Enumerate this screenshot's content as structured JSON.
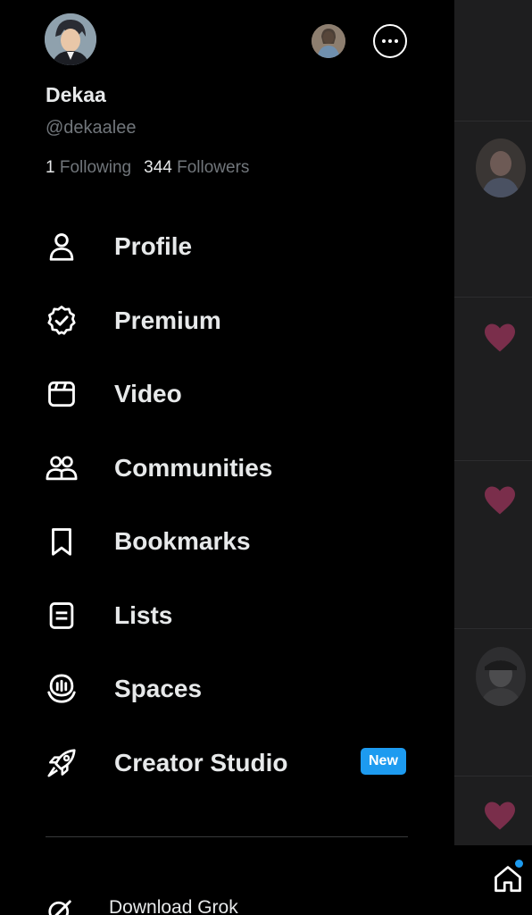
{
  "profile": {
    "display_name": "Dekaa",
    "handle": "@dekaalee",
    "following_count": "1",
    "following_label": "Following",
    "followers_count": "344",
    "followers_label": "Followers"
  },
  "menu": [
    {
      "label": "Profile",
      "icon": "person-icon"
    },
    {
      "label": "Premium",
      "icon": "verified-badge-icon"
    },
    {
      "label": "Video",
      "icon": "video-clapper-icon"
    },
    {
      "label": "Communities",
      "icon": "communities-icon"
    },
    {
      "label": "Bookmarks",
      "icon": "bookmark-icon"
    },
    {
      "label": "Lists",
      "icon": "list-icon"
    },
    {
      "label": "Spaces",
      "icon": "spaces-mic-icon"
    },
    {
      "label": "Creator Studio",
      "icon": "rocket-icon",
      "badge": "New"
    }
  ],
  "footer": {
    "grok_label": "Download Grok",
    "grok_icon": "grok-icon"
  },
  "colors": {
    "accent": "#1d9bf0",
    "text": "#e7e9ea",
    "muted": "#71767b",
    "heart_dimmed": "#7a2e4b"
  }
}
